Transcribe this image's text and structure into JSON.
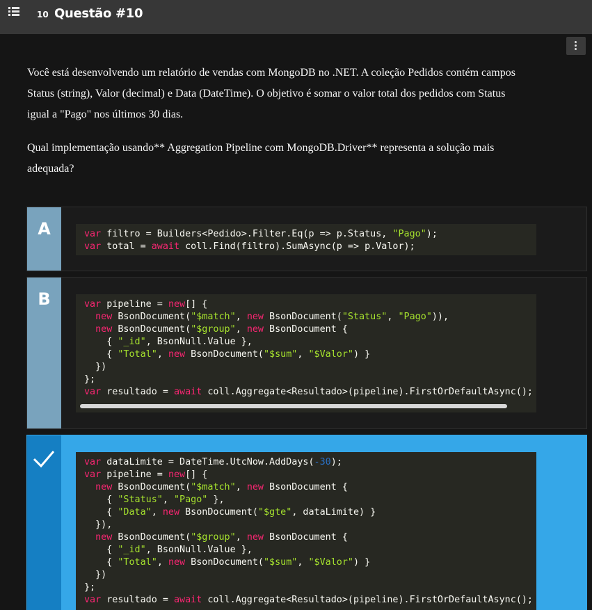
{
  "header": {
    "question_number": "10",
    "title": "Questão #10"
  },
  "question": {
    "paragraph1": "Você está desenvolvendo um relatório de vendas com MongoDB no .NET. A coleção Pedidos contém campos Status (string), Valor (decimal) e Data (DateTime). O objetivo é somar o valor total dos pedidos com Status igual a \"Pago\" nos últimos 30 dias.",
    "paragraph2": "Qual implementação usando** Aggregation Pipeline com MongoDB.Driver** representa a solução mais adequada?"
  },
  "options": [
    {
      "letter": "A",
      "state": "normal",
      "code": [
        [
          [
            "kw",
            "var"
          ],
          [
            "p",
            " filtro = Builders<Pedido>.Filter.Eq(p => p.Status, "
          ],
          [
            "st",
            "\"Pago\""
          ],
          [
            "p",
            ");"
          ]
        ],
        [
          [
            "kw",
            "var"
          ],
          [
            "p",
            " total = "
          ],
          [
            "kw",
            "await"
          ],
          [
            "p",
            " coll.Find(filtro).SumAsync(p => p.Valor);"
          ]
        ]
      ]
    },
    {
      "letter": "B",
      "state": "normal",
      "code": [
        [
          [
            "kw",
            "var"
          ],
          [
            "p",
            " pipeline = "
          ],
          [
            "kw",
            "new"
          ],
          [
            "p",
            "[] {"
          ]
        ],
        [
          [
            "p",
            "  "
          ],
          [
            "kw",
            "new"
          ],
          [
            "p",
            " BsonDocument("
          ],
          [
            "st",
            "\"$match\""
          ],
          [
            "p",
            ", "
          ],
          [
            "kw",
            "new"
          ],
          [
            "p",
            " BsonDocument("
          ],
          [
            "st",
            "\"Status\""
          ],
          [
            "p",
            ", "
          ],
          [
            "st",
            "\"Pago\""
          ],
          [
            "p",
            ")),"
          ]
        ],
        [
          [
            "p",
            "  "
          ],
          [
            "kw",
            "new"
          ],
          [
            "p",
            " BsonDocument("
          ],
          [
            "st",
            "\"$group\""
          ],
          [
            "p",
            ", "
          ],
          [
            "kw",
            "new"
          ],
          [
            "p",
            " BsonDocument {"
          ]
        ],
        [
          [
            "p",
            "    { "
          ],
          [
            "st",
            "\"_id\""
          ],
          [
            "p",
            ", BsonNull.Value },"
          ]
        ],
        [
          [
            "p",
            "    { "
          ],
          [
            "st",
            "\"Total\""
          ],
          [
            "p",
            ", "
          ],
          [
            "kw",
            "new"
          ],
          [
            "p",
            " BsonDocument("
          ],
          [
            "st",
            "\"$sum\""
          ],
          [
            "p",
            ", "
          ],
          [
            "st",
            "\"$Valor\""
          ],
          [
            "p",
            ") }"
          ]
        ],
        [
          [
            "p",
            "  })"
          ]
        ],
        [
          [
            "p",
            "};"
          ]
        ],
        [
          [
            "kw",
            "var"
          ],
          [
            "p",
            " resultado = "
          ],
          [
            "kw",
            "await"
          ],
          [
            "p",
            " coll.Aggregate<Resultado>(pipeline).FirstOrDefaultAsync();"
          ]
        ]
      ]
    },
    {
      "letter": "C",
      "state": "correct",
      "check_icon": "checkmark-icon",
      "code": [
        [
          [
            "kw",
            "var"
          ],
          [
            "p",
            " dataLimite = DateTime.UtcNow.AddDays("
          ],
          [
            "nm",
            "-30"
          ],
          [
            "p",
            ");"
          ]
        ],
        [
          [
            "kw",
            "var"
          ],
          [
            "p",
            " pipeline = "
          ],
          [
            "kw",
            "new"
          ],
          [
            "p",
            "[] {"
          ]
        ],
        [
          [
            "p",
            "  "
          ],
          [
            "kw",
            "new"
          ],
          [
            "p",
            " BsonDocument("
          ],
          [
            "st",
            "\"$match\""
          ],
          [
            "p",
            ", "
          ],
          [
            "kw",
            "new"
          ],
          [
            "p",
            " BsonDocument {"
          ]
        ],
        [
          [
            "p",
            "    { "
          ],
          [
            "st",
            "\"Status\""
          ],
          [
            "p",
            ", "
          ],
          [
            "st",
            "\"Pago\""
          ],
          [
            "p",
            " },"
          ]
        ],
        [
          [
            "p",
            "    { "
          ],
          [
            "st",
            "\"Data\""
          ],
          [
            "p",
            ", "
          ],
          [
            "kw",
            "new"
          ],
          [
            "p",
            " BsonDocument("
          ],
          [
            "st",
            "\"$gte\""
          ],
          [
            "p",
            ", dataLimite) }"
          ]
        ],
        [
          [
            "p",
            "  }),"
          ]
        ],
        [
          [
            "p",
            "  "
          ],
          [
            "kw",
            "new"
          ],
          [
            "p",
            " BsonDocument("
          ],
          [
            "st",
            "\"$group\""
          ],
          [
            "p",
            ", "
          ],
          [
            "kw",
            "new"
          ],
          [
            "p",
            " BsonDocument {"
          ]
        ],
        [
          [
            "p",
            "    { "
          ],
          [
            "st",
            "\"_id\""
          ],
          [
            "p",
            ", BsonNull.Value },"
          ]
        ],
        [
          [
            "p",
            "    { "
          ],
          [
            "st",
            "\"Total\""
          ],
          [
            "p",
            ", "
          ],
          [
            "kw",
            "new"
          ],
          [
            "p",
            " BsonDocument("
          ],
          [
            "st",
            "\"$sum\""
          ],
          [
            "p",
            ", "
          ],
          [
            "st",
            "\"$Valor\""
          ],
          [
            "p",
            ") }"
          ]
        ],
        [
          [
            "p",
            "  })"
          ]
        ],
        [
          [
            "p",
            "};"
          ]
        ],
        [
          [
            "kw",
            "var"
          ],
          [
            "p",
            " resultado = "
          ],
          [
            "kw",
            "await"
          ],
          [
            "p",
            " coll.Aggregate<Resultado>(pipeline).FirstOrDefaultAsync();"
          ]
        ]
      ]
    }
  ],
  "colors": {
    "keyword": "#f92672",
    "string": "#a6e22e",
    "number": "#2a72c8",
    "code_background": "#272822",
    "correct_option": "#35a7e8",
    "option_letter": "#79a3bd"
  },
  "icons": {
    "menu": "list-menu-icon",
    "more": "more-vertical-icon"
  }
}
